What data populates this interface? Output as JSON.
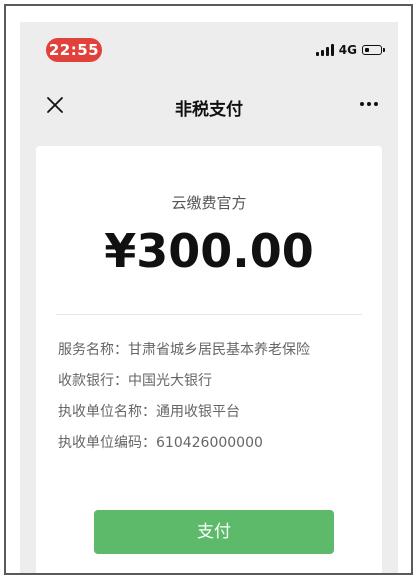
{
  "status_bar": {
    "time": "22:55",
    "network": "4G",
    "battery_level": 0.3
  },
  "nav": {
    "title": "非税支付",
    "close_icon": "close-icon",
    "more_icon": "more-icon"
  },
  "payment": {
    "merchant": "云缴费官方",
    "amount": "¥300.00"
  },
  "details": [
    {
      "text": "服务名称：甘肃省城乡居民基本养老保险"
    },
    {
      "text": "收款银行：中国光大银行"
    },
    {
      "text": "执收单位名称：通用收银平台"
    },
    {
      "text": "执收单位编码：610426000000"
    }
  ],
  "actions": {
    "pay_label": "支付"
  },
  "colors": {
    "time_pill": "#e0413a",
    "pay_button": "#5cba6a",
    "background": "#ededed"
  }
}
